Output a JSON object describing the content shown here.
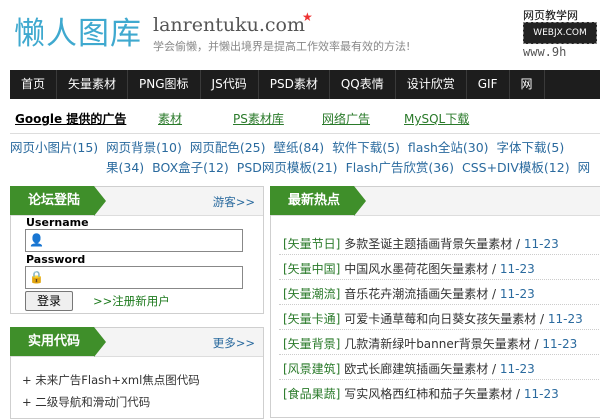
{
  "header": {
    "logo": "懒人图库",
    "domain": "lanrentuku.com",
    "star": "★",
    "slogan": "学会偷懒，并懒出境界是提高工作效率最有效的方法!",
    "badge_line1": "网页教学网",
    "badge_line2": "WEBJX.COM",
    "badge_line3": "www.9h"
  },
  "nav": [
    "首页",
    "矢量素材",
    "PNG图标",
    "JS代码",
    "PSD素材",
    "QQ表情",
    "设计欣赏",
    "GIF",
    "网"
  ],
  "adbar": {
    "google": "Google 提供的广告",
    "links": [
      "素材",
      "PS素材库",
      "网络广告",
      "MySQL下载"
    ]
  },
  "tags": {
    "row1": [
      "网页小图片(15)",
      "网页背景(10)",
      "网页配色(25)",
      "壁纸(84)",
      "软件下载(5)",
      "flash全站(30)",
      "字体下载(5)"
    ],
    "row2": [
      "果(34)",
      "BOX盒子(12)",
      "PSD网页模板(21)",
      "Flash广告欣赏(36)",
      "CSS+DIV模板(12)",
      "网"
    ]
  },
  "login": {
    "title": "论坛登陆",
    "more": "游客>>",
    "username_label": "Username",
    "username_value": "",
    "password_label": "Password",
    "password_value": "",
    "submit": "登录",
    "register": ">>注册新用户"
  },
  "code": {
    "title": "实用代码",
    "more": "更多>>",
    "items": [
      "+ 未来广告Flash+xml焦点图代码",
      "+ 二级导航和滑动门代码"
    ]
  },
  "hot": {
    "title": "最新热点",
    "items": [
      {
        "cat": "[矢量节日]",
        "text": " 多款圣诞主题插画背景矢量素材 / ",
        "date": "11-23"
      },
      {
        "cat": "[矢量中国]",
        "text": " 中国风水墨荷花图矢量素材 / ",
        "date": "11-23"
      },
      {
        "cat": "[矢量潮流]",
        "text": " 音乐花卉潮流插画矢量素材 / ",
        "date": "11-23"
      },
      {
        "cat": "[矢量卡通]",
        "text": " 可爱卡通草莓和向日葵女孩矢量素材 / ",
        "date": "11-23"
      },
      {
        "cat": "[矢量背景]",
        "text": " 几款清新绿叶banner背景矢量素材 / ",
        "date": "11-23"
      },
      {
        "cat": "[风景建筑]",
        "text": " 欧式长廊建筑插画矢量素材 / ",
        "date": "11-23"
      },
      {
        "cat": "[食品果蔬]",
        "text": " 写实风格西红柿和茄子矢量素材 / ",
        "date": "11-23"
      }
    ]
  },
  "colors": {
    "nav_bg": "#1d1d1d",
    "accent_green": "#3f8f2a",
    "logo_blue": "#3fa9cf",
    "link_blue": "#2a6a9e"
  }
}
